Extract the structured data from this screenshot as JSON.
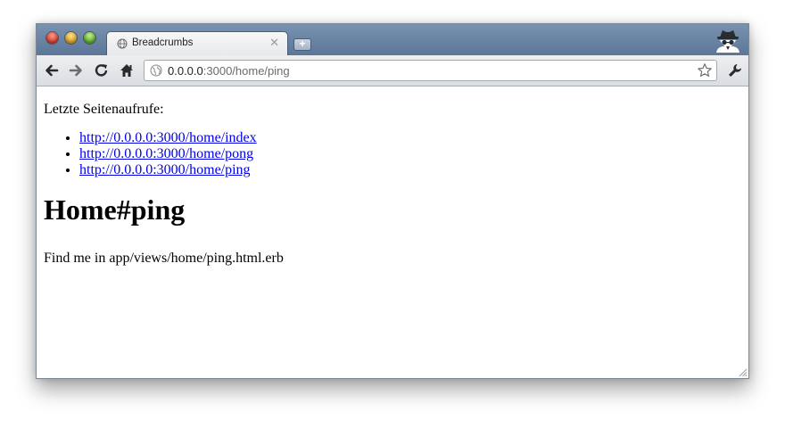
{
  "browser": {
    "tab": {
      "title": "Breadcrumbs"
    },
    "newtab_icon": "plus-icon",
    "address": {
      "host": "0.0.0.0",
      "rest": ":3000/home/ping"
    },
    "icons": [
      "back-arrow-icon",
      "forward-arrow-icon",
      "reload-icon",
      "home-icon",
      "globe-icon",
      "bookmark-star-icon",
      "wrench-icon",
      "incognito-icon"
    ]
  },
  "page": {
    "intro": "Letzte Seitenaufrufe:",
    "links": [
      "http://0.0.0.0:3000/home/index",
      "http://0.0.0.0:3000/home/pong",
      "http://0.0.0.0:3000/home/ping"
    ],
    "heading": "Home#ping",
    "note": "Find me in app/views/home/ping.html.erb"
  },
  "colors": {
    "titlebar": "#6882a3",
    "link": "#0000ee"
  }
}
